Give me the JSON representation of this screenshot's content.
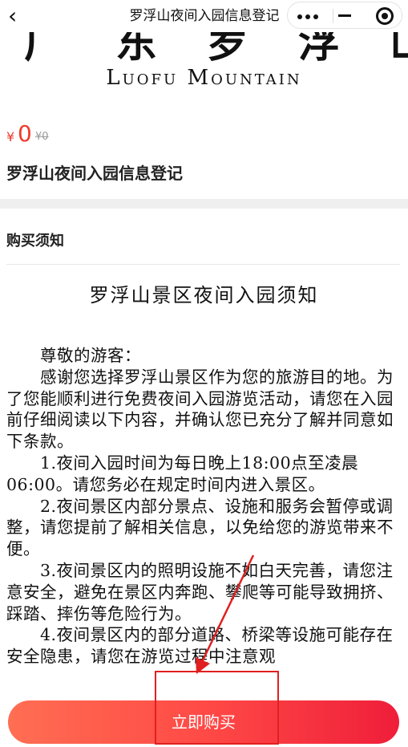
{
  "nav": {
    "back_icon": "chevron-left-icon",
    "title": "罗浮山夜间入园信息登记",
    "more_icon": "more-dots-icon",
    "minimize_icon": "minimize-icon",
    "close_icon": "target-close-icon"
  },
  "banner": {
    "chinese_text": "广东罗浮山",
    "english_text": "Luofu Mountain"
  },
  "product": {
    "price_symbol": "¥",
    "price": "0",
    "original_price": "¥0",
    "title": "罗浮山夜间入园信息登记"
  },
  "notice": {
    "heading": "购买须知",
    "doc_title": "罗浮山景区夜间入园须知",
    "paragraphs": [
      "尊敬的游客：",
      "感谢您选择罗浮山景区作为您的旅游目的地。为了您能顺利进行免费夜间入园游览活动，请您在入园前仔细阅读以下内容，并确认您已充分了解并同意如下条款。",
      "1.夜间入园时间为每日晚上18:00点至凌晨06:00。请您务必在规定时间内进入景区。",
      "2.夜间景区内部分景点、设施和服务会暂停或调整，请您提前了解相关信息，以免给您的游览带来不便。",
      "3.夜间景区内的照明设施不如白天完善，请您注意安全，避免在景区内奔跑、攀爬等可能导致拥挤、踩踏、摔伤等危险行为。",
      "4.夜间景区内的部分道路、桥梁等设施可能存在安全隐患，请您在游览过程中注意观"
    ]
  },
  "footer": {
    "buy_label": "立即购买"
  },
  "colors": {
    "accent": "#ee3b2b",
    "button_gradient_start": "#ff6e53",
    "button_gradient_end": "#ef1e3a",
    "annotation": "#e02020"
  }
}
